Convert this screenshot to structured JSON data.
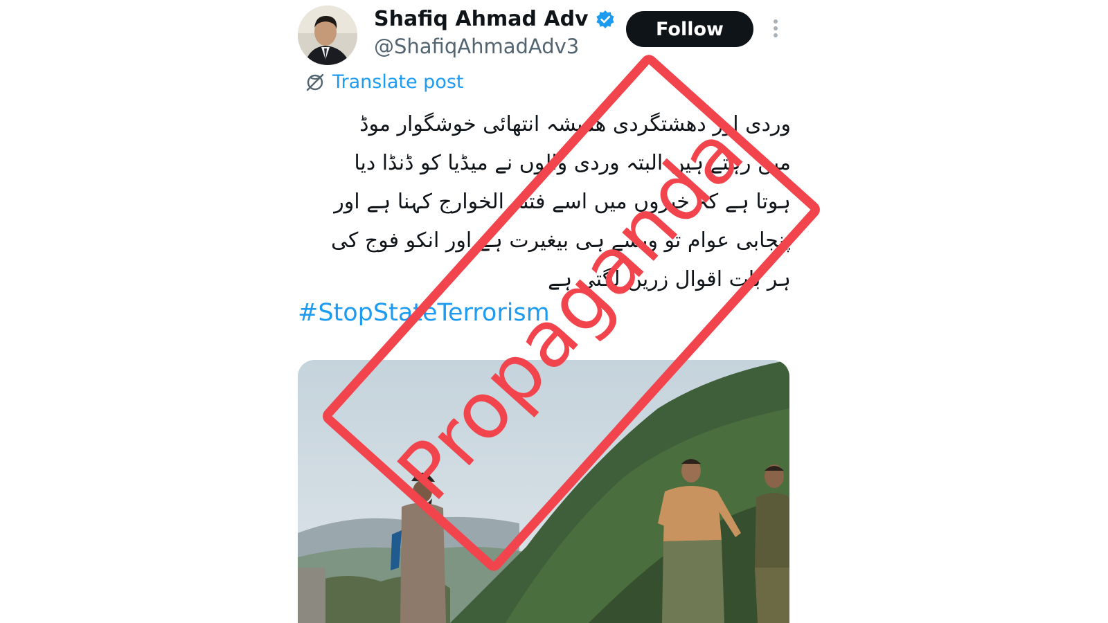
{
  "author": {
    "display_name": "Shafiq Ahmad Adv",
    "handle": "@ShafiqAhmadAdv3",
    "verified": true
  },
  "actions": {
    "follow_label": "Follow",
    "translate_label": "Translate post"
  },
  "post": {
    "lines": [
      "وردی اور دهشتگردی همیشہ انتهائی خوشگوار موڈ",
      "میں رہتے ہیں البتہ وردی والوں نے میڈیا کو ڈنڈا دیا",
      "ہوتا ہے کہ خبروں میں اسے فتنہ الخوارج کہنا ہے اور",
      "پنجابی عوام تو ویسے ہی بیغیرت ہے اور انکو فوج کی",
      "ہر بات اقوال زریں لگتی ہے"
    ],
    "hashtag": "#StopStateTerrorism"
  },
  "overlay": {
    "stamp_text": "Propaganda",
    "stamp_color": "#f1444d"
  },
  "colors": {
    "link": "#1d9bf0",
    "text": "#0f1419",
    "muted": "#536471",
    "button": "#0f1419"
  }
}
